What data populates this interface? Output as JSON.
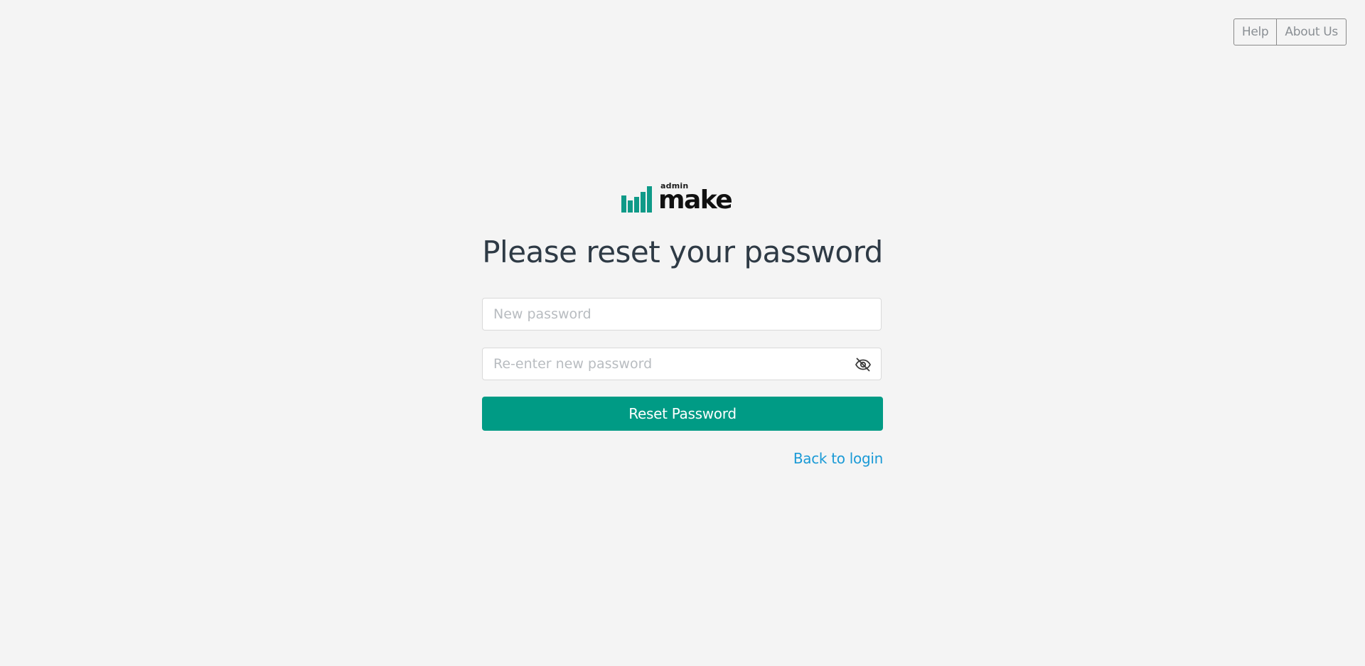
{
  "top_nav": {
    "help_label": "Help",
    "about_label": "About Us"
  },
  "logo": {
    "small_text": "admin",
    "word": "make",
    "brand_color": "#0f9a88"
  },
  "page_title": "Please reset your password",
  "form": {
    "new_password": {
      "placeholder": "New password",
      "value": ""
    },
    "confirm_password": {
      "placeholder": "Re-enter new password",
      "value": "",
      "toggle_icon": "eye-off-icon"
    },
    "submit_label": "Reset Password",
    "submit_color": "#009b85"
  },
  "back_link": {
    "label": "Back to login",
    "color": "#1a9ad6"
  }
}
